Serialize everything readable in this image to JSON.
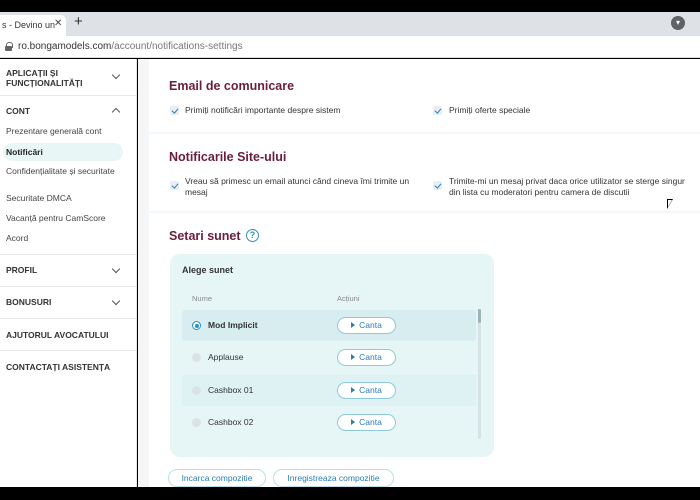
{
  "browser": {
    "tab_title": "s - Devino un",
    "tab_close": "✕",
    "new_tab": "+",
    "url_host": "ro.bongamodels.com",
    "url_path": "/account/notifications-settings"
  },
  "sidebar": {
    "sections": [
      {
        "label": "APLICAȚII ȘI FUNCȚIONALITĂȚI",
        "expanded": false
      },
      {
        "label": "CONT",
        "expanded": true
      },
      {
        "label": "PROFIL",
        "expanded": false
      },
      {
        "label": "BONUSURI",
        "expanded": false
      },
      {
        "label": "AJUTORUL AVOCATULUI"
      },
      {
        "label": "CONTACTAȚI ASISTENȚA"
      }
    ],
    "cont_items": [
      {
        "label": "Prezentare generală cont"
      },
      {
        "label": "Notificări",
        "active": true
      },
      {
        "label": "Confidențialitate și securitate"
      },
      {
        "label": "Securitate DMCA"
      },
      {
        "label": "Vacanță pentru CamScore"
      },
      {
        "label": "Acord"
      }
    ]
  },
  "email": {
    "title": "Email de comunicare",
    "options": [
      "Primiți notificări importante despre sistem",
      "Primiți oferte speciale"
    ]
  },
  "site": {
    "title": "Notificarile Site-ului",
    "options": [
      "Vreau să primesc un email atunci când cineva îmi trimite un mesaj",
      "Trimite-mi un mesaj privat daca orice utilizator se sterge singur din lista cu moderatori pentru camera de discutii"
    ]
  },
  "sound": {
    "title": "Setari sunet",
    "help_glyph": "?",
    "panel_title": "Alege sunet",
    "col_name": "Nume",
    "col_actions": "Acțiuni",
    "play_label": "Canta",
    "rows": [
      {
        "name": "Mod Implicit",
        "selected": true
      },
      {
        "name": "Applause",
        "selected": false
      },
      {
        "name": "Cashbox 01",
        "selected": false
      },
      {
        "name": "Cashbox 02",
        "selected": false
      }
    ],
    "upload_label": "Incarca compozitie",
    "record_label": "Inregistreaza compozitie"
  },
  "colors": {
    "accent": "#2a7db5",
    "heading": "#6b1d3a",
    "panel": "#e6f6f7"
  }
}
